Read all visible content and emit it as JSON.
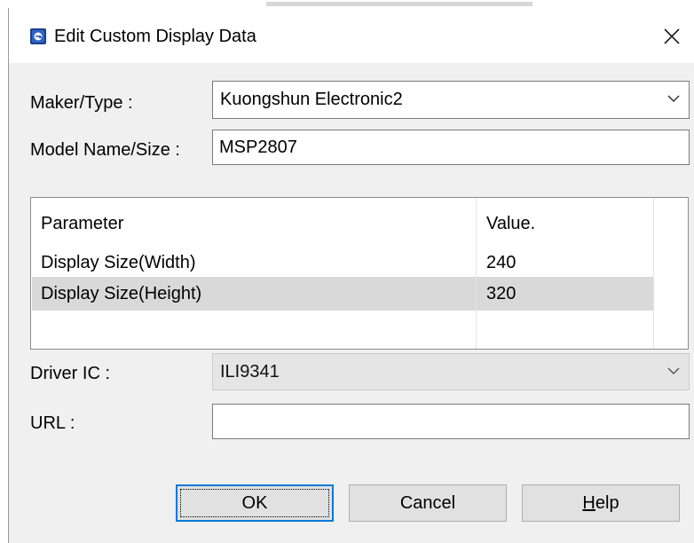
{
  "dialog": {
    "title": "Edit Custom Display Data",
    "icon": "app-icon",
    "close": "close-icon"
  },
  "form": {
    "maker_label": "Maker/Type :",
    "maker_value": "Kuongshun Electronic2",
    "model_label": "Model Name/Size :",
    "model_value": "MSP2807",
    "driver_label": "Driver IC :",
    "driver_value": "ILI9341",
    "url_label": "URL :",
    "url_value": ""
  },
  "grid": {
    "headers": [
      "Parameter",
      "Value."
    ],
    "rows": [
      {
        "parameter": "Display Size(Width)",
        "value": "240"
      },
      {
        "parameter": "Display Size(Height)",
        "value": "320"
      }
    ],
    "selected_row": 1
  },
  "buttons": {
    "ok": "OK",
    "cancel": "Cancel",
    "help_first": "H",
    "help_rest": "elp"
  },
  "colors": {
    "dialog_bg": "#f0f0f0",
    "selection": "#d9d9d9",
    "default_button_border": "#0078d7"
  }
}
